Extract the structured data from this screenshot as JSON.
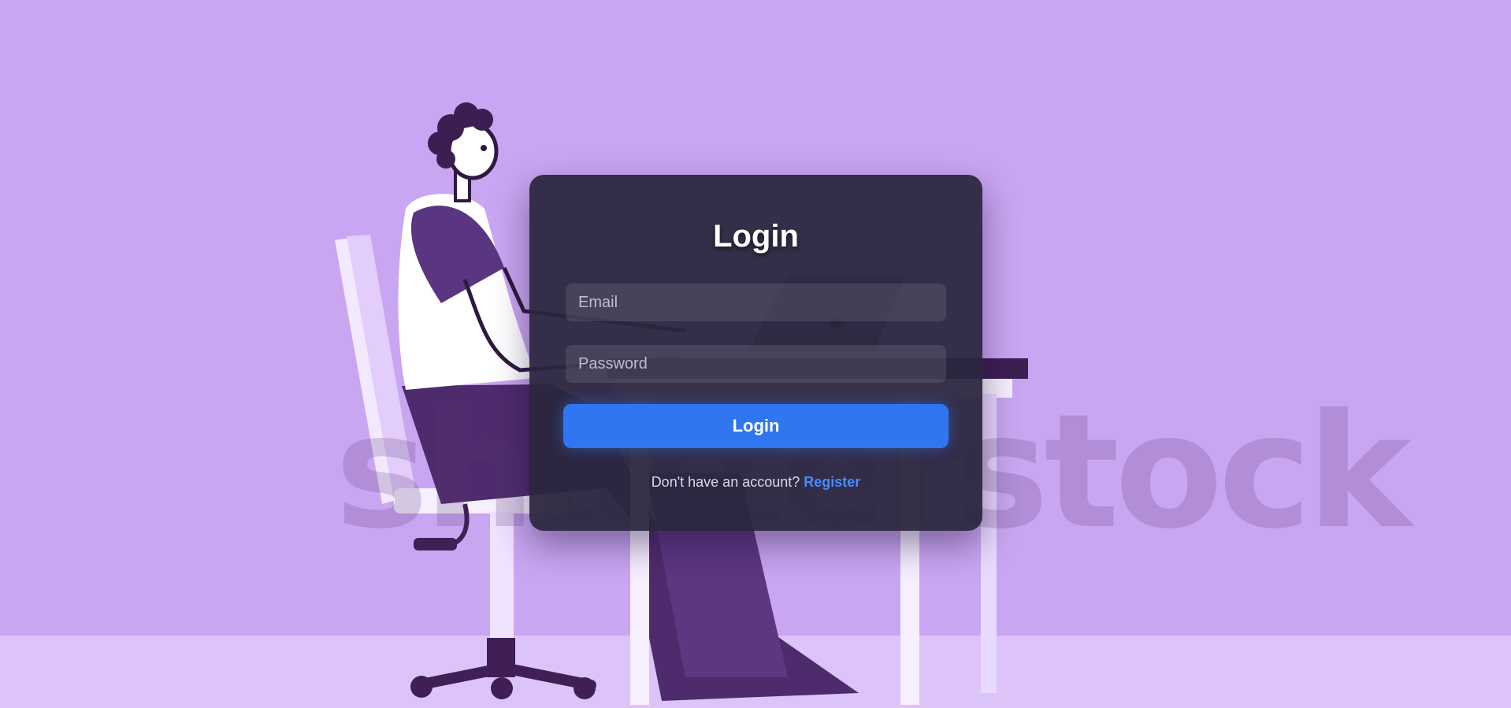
{
  "form": {
    "title": "Login",
    "email_placeholder": "Email",
    "email_value": "",
    "password_placeholder": "Password",
    "password_value": "",
    "submit_label": "Login",
    "register_prompt": "Don't have an account?",
    "register_link": "Register"
  },
  "background": {
    "watermark_text": "shutterstock"
  },
  "colors": {
    "background": "#c9a6f1",
    "card": "#2a263e",
    "button": "#2f76f0",
    "link": "#4a8bff"
  }
}
